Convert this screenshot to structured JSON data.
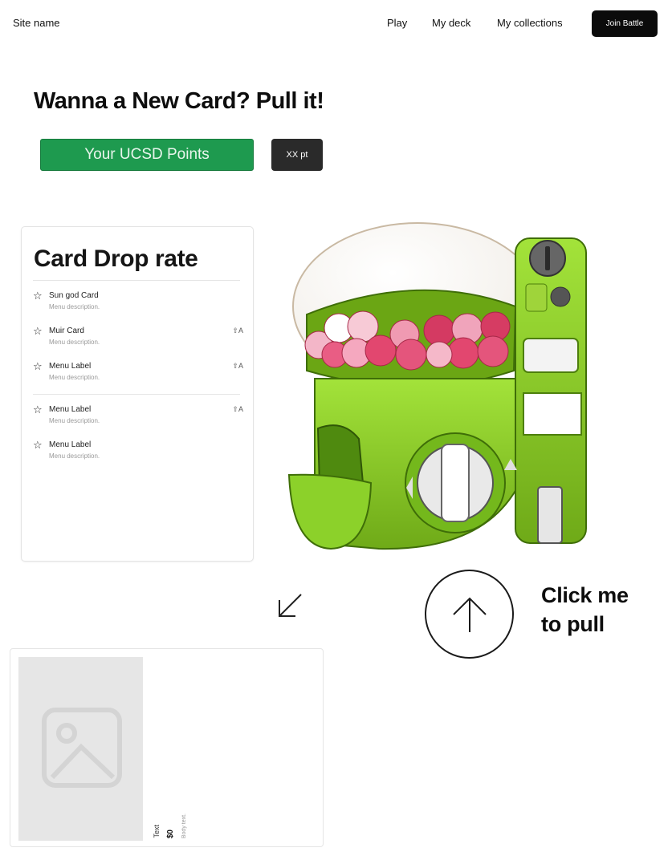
{
  "header": {
    "site_name": "Site name",
    "nav": [
      "Play",
      "My deck",
      "My collections"
    ],
    "join_label": "Join Battle"
  },
  "hero": {
    "headline": "Wanna a New Card? Pull it!",
    "points_label": "Your UCSD Points",
    "points_value": "XX pt"
  },
  "drop_rate": {
    "title": "Card Drop rate",
    "items": [
      {
        "label": "Sun god Card",
        "description": "Menu description.",
        "shortcut": ""
      },
      {
        "label": "Muir Card",
        "description": "Menu description.",
        "shortcut": "⇧A"
      },
      {
        "label": "Menu Label",
        "description": "Menu description.",
        "shortcut": "⇧A"
      },
      {
        "label": "Menu Label",
        "description": "Menu description.",
        "shortcut": "⇧A"
      },
      {
        "label": "Menu Label",
        "description": "Menu description.",
        "shortcut": ""
      }
    ]
  },
  "pull": {
    "line1": "Click me",
    "line2": "to pull"
  },
  "result_card": {
    "text": "Text",
    "price": "$0",
    "body": "Body text."
  },
  "colors": {
    "accent_green": "#1e9a4f",
    "machine_green": "#8cd12a",
    "capsule_pink": "#e2476f"
  }
}
